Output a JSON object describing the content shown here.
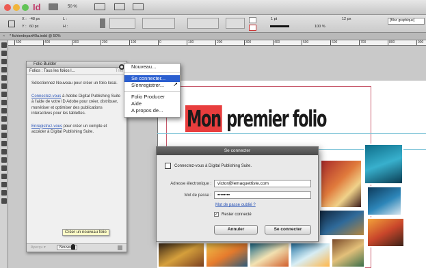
{
  "app": {
    "name": "Id",
    "zoom": "50 %"
  },
  "control_panel": {
    "x_label": "X :",
    "x_value": "-48 px",
    "y_label": "Y :",
    "y_value": "60 px",
    "l_label": "L :",
    "h_label": "H :",
    "stroke_weight": "1 pt",
    "scale": "100 %",
    "size": "12 px",
    "style": "[Bloc graphique]"
  },
  "document_tab": "* fichierdepart40a.indd @ 50%",
  "ruler_ticks": [
    "500",
    "400",
    "300",
    "200",
    "100",
    "0",
    "100",
    "200",
    "300",
    "400",
    "500",
    "600",
    "700",
    "800",
    "900"
  ],
  "folio_panel": {
    "title": "Folio Builder",
    "folios_label": "Folios : Tous les folios l...",
    "folios_right": "Trier",
    "para1": "Sélectionnez Nouveau pour créer un folio local.",
    "para2_link": "Connectez-vous",
    "para2_rest": " à Adobe Digital Publishing Suite à l'aide de votre ID Adobe pour créer, distribuer, monétiser et optimiser des publications interactives pour les tablettes.",
    "para3_link": "Enregistrez-vous",
    "para3_rest": " pour créer un compte et accéder à Digital Publishing Suite.",
    "footer_left": "Aperçu ▾",
    "footer_button": "Nouveau",
    "tooltip": "Créer un nouveau folio"
  },
  "panel_menu": {
    "items": [
      "Nouveau...",
      "Se connecter...",
      "S'enregistrer...",
      "Folio Producer",
      "Aide",
      "A propos de..."
    ],
    "highlighted": "Se connecter..."
  },
  "page": {
    "title_highlight": "Mon",
    "title_rest": " premier folio"
  },
  "dialog": {
    "title": "Se connecter",
    "header": "Connectez-vous à Digital Publishing Suite.",
    "email_label": "Adresse électronique :",
    "email_value": "victor@lemaquettiste.com",
    "password_label": "Mot de passe :",
    "password_value": "••••••••",
    "forgot_link": "Mot de passe oublié ?",
    "remember_label": "Rester connecté",
    "cancel": "Annuler",
    "login": "Se connecter"
  },
  "colors": {
    "accent": "#2b5fd0",
    "title_highlight": "#e83d3d",
    "link": "#2b55b8"
  }
}
